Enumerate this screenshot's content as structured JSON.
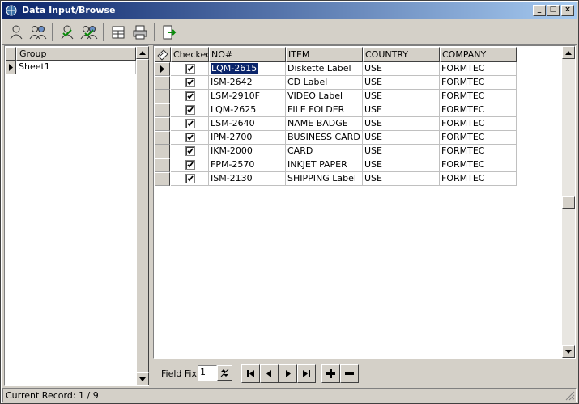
{
  "window": {
    "title": "Data Input/Browse"
  },
  "left_grid": {
    "header": "Group",
    "rows": [
      "Sheet1"
    ]
  },
  "grid": {
    "columns": [
      "Checked",
      "NO#",
      "ITEM",
      "COUNTRY",
      "COMPANY"
    ],
    "rows": [
      {
        "no": "LQM-2615",
        "item": "Diskette Label",
        "country": "USE",
        "company": "FORMTEC",
        "checked": true
      },
      {
        "no": "ISM-2642",
        "item": "CD Label",
        "country": "USE",
        "company": "FORMTEC",
        "checked": true
      },
      {
        "no": "LSM-2910F",
        "item": "VIDEO Label",
        "country": "USE",
        "company": "FORMTEC",
        "checked": true
      },
      {
        "no": "LQM-2625",
        "item": "FILE FOLDER",
        "country": "USE",
        "company": "FORMTEC",
        "checked": true
      },
      {
        "no": "LSM-2640",
        "item": "NAME BADGE",
        "country": "USE",
        "company": "FORMTEC",
        "checked": true
      },
      {
        "no": "IPM-2700",
        "item": "BUSINESS CARD",
        "country": "USE",
        "company": "FORMTEC",
        "checked": true
      },
      {
        "no": "IKM-2000",
        "item": "CARD",
        "country": "USE",
        "company": "FORMTEC",
        "checked": true
      },
      {
        "no": "FPM-2570",
        "item": "INKJET PAPER",
        "country": "USE",
        "company": "FORMTEC",
        "checked": true
      },
      {
        "no": "ISM-2130",
        "item": "SHIPPING Label",
        "country": "USE",
        "company": "FORMTEC",
        "checked": true
      }
    ]
  },
  "nav": {
    "field_fix_label": "Field Fix:",
    "field_fix_value": "1"
  },
  "status": {
    "text": "Current Record: 1 / 9"
  },
  "colors": {
    "title_start": "#0a246a",
    "title_end": "#a6caf0",
    "face": "#d4d0c8",
    "selection": "#0a246a"
  }
}
